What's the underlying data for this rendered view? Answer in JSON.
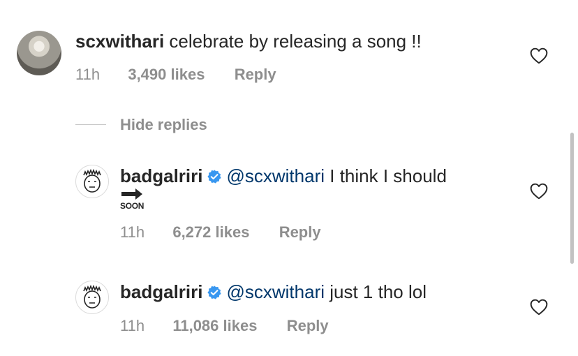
{
  "comments": [
    {
      "username": "scxwithari",
      "text": "celebrate by releasing a song !!",
      "time": "11h",
      "likes": "3,490 likes",
      "reply_label": "Reply"
    }
  ],
  "hide_replies_label": "Hide replies",
  "replies": [
    {
      "username": "badgalriri",
      "mention": "@scxwithari",
      "text": "I think I should",
      "sticker_label": "SOON",
      "time": "11h",
      "likes": "6,272 likes",
      "reply_label": "Reply"
    },
    {
      "username": "badgalriri",
      "mention": "@scxwithari",
      "text": "just 1 tho lol",
      "time": "11h",
      "likes": "11,086 likes",
      "reply_label": "Reply"
    }
  ],
  "icons": {
    "like": "heart-outline-icon",
    "verified": "verified-badge-icon"
  },
  "colors": {
    "mention": "#00376b",
    "verified": "#3897f0",
    "meta": "#8e8e8e"
  }
}
